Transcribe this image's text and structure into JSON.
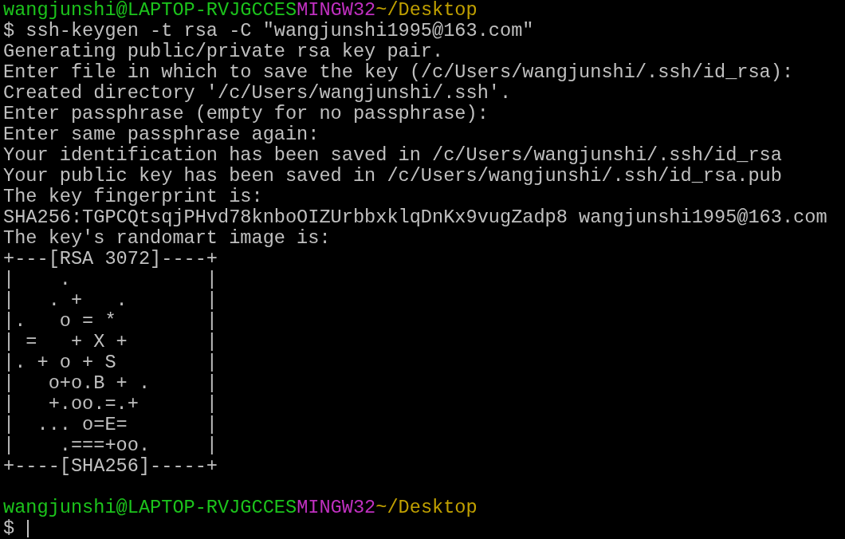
{
  "terminal": {
    "lines": [
      {
        "kind": "prompt",
        "user_host": "wangjunshi@LAPTOP-RVJGCCES",
        "shell": "MINGW32",
        "path": "~/Desktop"
      },
      {
        "kind": "output",
        "text": "$ ssh-keygen -t rsa -C \"wangjunshi1995@163.com\""
      },
      {
        "kind": "output",
        "text": "Generating public/private rsa key pair."
      },
      {
        "kind": "output",
        "text": "Enter file in which to save the key (/c/Users/wangjunshi/.ssh/id_rsa):"
      },
      {
        "kind": "output",
        "text": "Created directory '/c/Users/wangjunshi/.ssh'."
      },
      {
        "kind": "output",
        "text": "Enter passphrase (empty for no passphrase):"
      },
      {
        "kind": "output",
        "text": "Enter same passphrase again:"
      },
      {
        "kind": "output",
        "text": "Your identification has been saved in /c/Users/wangjunshi/.ssh/id_rsa"
      },
      {
        "kind": "output",
        "text": "Your public key has been saved in /c/Users/wangjunshi/.ssh/id_rsa.pub"
      },
      {
        "kind": "output",
        "text": "The key fingerprint is:"
      },
      {
        "kind": "output",
        "text": "SHA256:TGPCQtsqjPHvd78knboOIZUrbbxklqDnKx9vugZadp8 wangjunshi1995@163.com"
      },
      {
        "kind": "output",
        "text": "The key's randomart image is:"
      },
      {
        "kind": "output",
        "text": "+---[RSA 3072]----+"
      },
      {
        "kind": "output",
        "text": "|    .            |"
      },
      {
        "kind": "output",
        "text": "|   . +   .       |"
      },
      {
        "kind": "output",
        "text": "|.   o = *        |"
      },
      {
        "kind": "output",
        "text": "| =   + X +       |"
      },
      {
        "kind": "output",
        "text": "|. + o + S        |"
      },
      {
        "kind": "output",
        "text": "|   o+o.B + .     |"
      },
      {
        "kind": "output",
        "text": "|   +.oo.=.+      |"
      },
      {
        "kind": "output",
        "text": "|  ... o=E=       |"
      },
      {
        "kind": "output",
        "text": "|    .===+oo.     |"
      },
      {
        "kind": "output",
        "text": "+----[SHA256]-----+"
      },
      {
        "kind": "blank"
      },
      {
        "kind": "prompt",
        "user_host": "wangjunshi@LAPTOP-RVJGCCES",
        "shell": "MINGW32",
        "path": "~/Desktop"
      },
      {
        "kind": "input",
        "text": "$ ",
        "cursor": true
      }
    ]
  }
}
